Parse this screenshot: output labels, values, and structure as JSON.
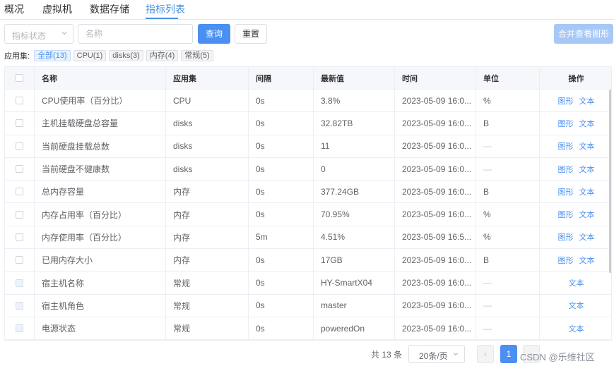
{
  "tabs": [
    {
      "label": "概况"
    },
    {
      "label": "虚拟机"
    },
    {
      "label": "数据存储"
    },
    {
      "label": "指标列表"
    }
  ],
  "filter": {
    "status_placeholder": "指标状态",
    "name_placeholder": "名称",
    "query_label": "查询",
    "reset_label": "重置",
    "merge_label": "合并查看图形"
  },
  "appset": {
    "label": "应用集:",
    "chips": [
      "全部(13)",
      "CPU(1)",
      "disks(3)",
      "内存(4)",
      "常规(5)"
    ]
  },
  "table": {
    "headers": [
      "名称",
      "应用集",
      "间隔",
      "最新值",
      "时间",
      "单位",
      "操作"
    ],
    "rows": [
      {
        "name": "CPU使用率（百分比）",
        "app": "CPU",
        "interval": "0s",
        "value": "3.8%",
        "time": "2023-05-09 16:0...",
        "unit": "%",
        "graph": "图形",
        "text": "文本"
      },
      {
        "name": "主机挂载硬盘总容量",
        "app": "disks",
        "interval": "0s",
        "value": "32.82TB",
        "time": "2023-05-09 16:0...",
        "unit": "B",
        "graph": "图形",
        "text": "文本"
      },
      {
        "name": "当前硬盘挂载总数",
        "app": "disks",
        "interval": "0s",
        "value": "11",
        "time": "2023-05-09 16:0...",
        "unit": "—",
        "graph": "图形",
        "text": "文本"
      },
      {
        "name": "当前硬盘不健康数",
        "app": "disks",
        "interval": "0s",
        "value": "0",
        "time": "2023-05-09 16:0...",
        "unit": "—",
        "graph": "图形",
        "text": "文本"
      },
      {
        "name": "总内存容量",
        "app": "内存",
        "interval": "0s",
        "value": "377.24GB",
        "time": "2023-05-09 16:0...",
        "unit": "B",
        "graph": "图形",
        "text": "文本"
      },
      {
        "name": "内存占用率（百分比）",
        "app": "内存",
        "interval": "0s",
        "value": "70.95%",
        "time": "2023-05-09 16:0...",
        "unit": "%",
        "graph": "图形",
        "text": "文本"
      },
      {
        "name": "内存使用率（百分比）",
        "app": "内存",
        "interval": "5m",
        "value": "4.51%",
        "time": "2023-05-09 16:5...",
        "unit": "%",
        "graph": "图形",
        "text": "文本"
      },
      {
        "name": "已用内存大小",
        "app": "内存",
        "interval": "0s",
        "value": "17GB",
        "time": "2023-05-09 16:0...",
        "unit": "B",
        "graph": "图形",
        "text": "文本"
      },
      {
        "name": "宿主机名称",
        "app": "常规",
        "interval": "0s",
        "value": "HY-SmartX04",
        "time": "2023-05-09 16:0...",
        "unit": "—",
        "graph": "",
        "text": "文本"
      },
      {
        "name": "宿主机角色",
        "app": "常规",
        "interval": "0s",
        "value": "master",
        "time": "2023-05-09 16:0...",
        "unit": "—",
        "graph": "",
        "text": "文本"
      },
      {
        "name": "电源状态",
        "app": "常规",
        "interval": "0s",
        "value": "poweredOn",
        "time": "2023-05-09 16:0...",
        "unit": "—",
        "graph": "",
        "text": "文本"
      }
    ]
  },
  "pager": {
    "total": "共 13 条",
    "size": "20条/页",
    "page": "1",
    "prev": "‹",
    "next": "›"
  },
  "watermark": "CSDN @乐维社区"
}
